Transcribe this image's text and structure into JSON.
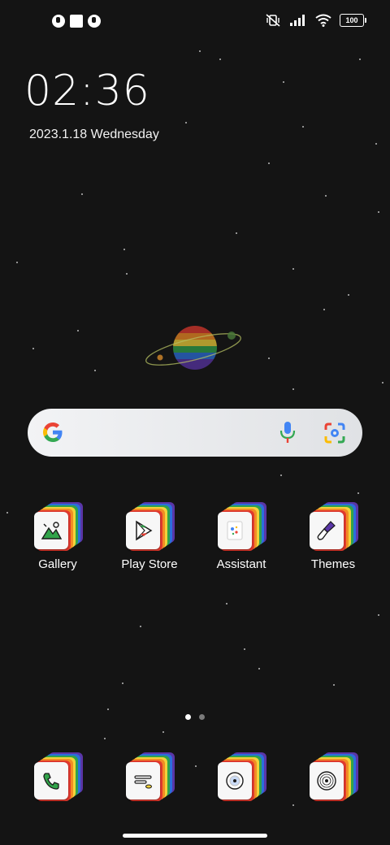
{
  "status_bar": {
    "battery_level": "100",
    "notification_icons": [
      "app-notification-icon",
      "square-notification-icon",
      "app-notification-icon"
    ],
    "right_icons": [
      "vibrate-mute-icon",
      "signal-icon",
      "wifi-icon",
      "battery-icon"
    ]
  },
  "lockscreen_widget": {
    "time": "02:36",
    "date": "2023.1.18 Wednesday"
  },
  "search_bar": {
    "logo_icon": "google-g-icon",
    "voice_icon": "microphone-icon",
    "lens_icon": "camera-lens-icon"
  },
  "apps": [
    {
      "label": "Gallery",
      "icon": "gallery-icon"
    },
    {
      "label": "Play Store",
      "icon": "play-store-icon"
    },
    {
      "label": "Assistant",
      "icon": "assistant-icon"
    },
    {
      "label": "Themes",
      "icon": "themes-icon"
    }
  ],
  "dock": [
    {
      "icon": "phone-icon"
    },
    {
      "icon": "messages-icon"
    },
    {
      "icon": "browser-icon"
    },
    {
      "icon": "music-icon"
    }
  ],
  "page_indicator": {
    "pages": 2,
    "current": 1
  },
  "colors": {
    "background": "#141414",
    "search_bar": "#ebecee",
    "rainbow": [
      "#e23a2e",
      "#f28c24",
      "#f3d23a",
      "#31a34a",
      "#2b6fdc",
      "#5a36a8"
    ]
  }
}
